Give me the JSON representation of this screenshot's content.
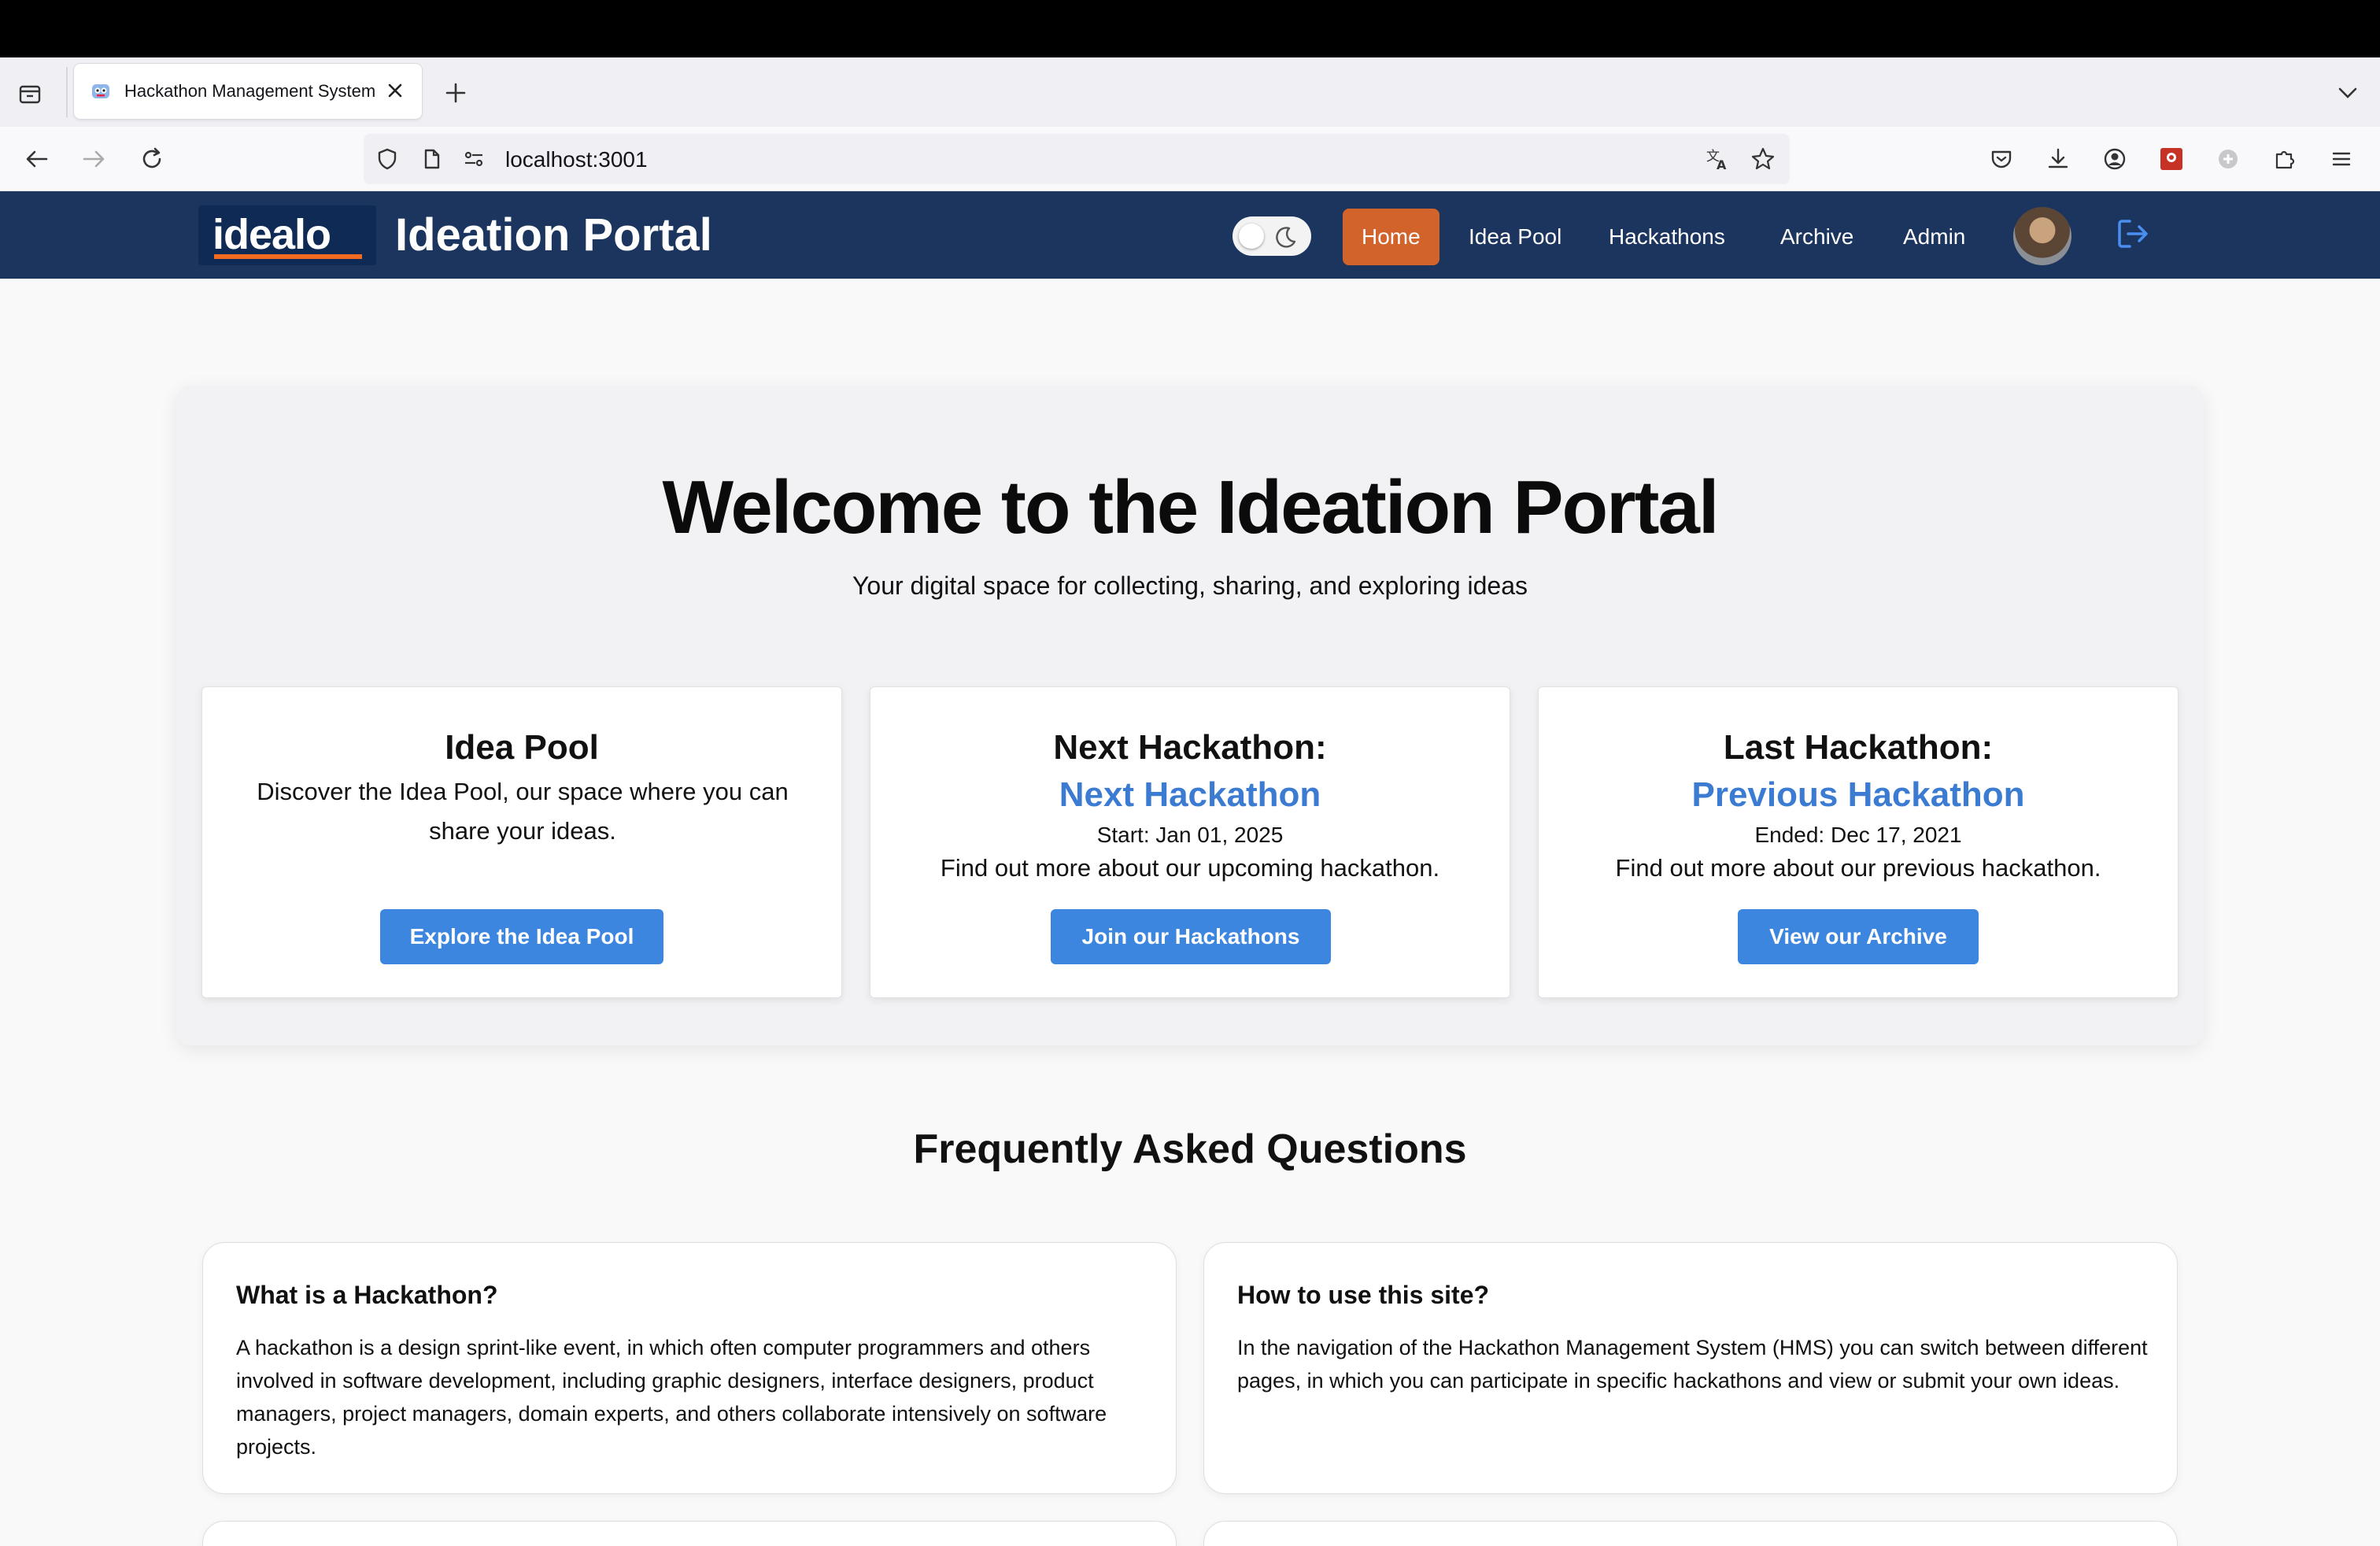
{
  "browser": {
    "tab": {
      "title": "Hackathon Management System"
    },
    "url": "localhost:3001",
    "icons": {
      "tab_list": "tab-list-icon",
      "tab_close": "close-icon",
      "new_tab": "plus-icon",
      "tab_overflow": "chevron-down-icon",
      "back": "back-arrow-icon",
      "forward": "forward-arrow-icon",
      "reload": "reload-icon",
      "shield": "shield-icon",
      "page": "page-icon",
      "permissions": "permissions-icon",
      "translate": "translate-icon",
      "bookmark": "star-icon",
      "pocket": "pocket-icon",
      "downloads": "download-icon",
      "account": "account-icon",
      "extension1": "extension-icon",
      "extension2": "extension-icon",
      "extensions": "puzzle-icon",
      "menu": "hamburger-menu-icon"
    }
  },
  "header": {
    "logo": "idealo",
    "title": "Ideation Portal",
    "nav": [
      {
        "label": "Home",
        "active": true
      },
      {
        "label": "Idea Pool",
        "active": false
      },
      {
        "label": "Hackathons",
        "active": false
      },
      {
        "label": "Archive",
        "active": false
      },
      {
        "label": "Admin",
        "active": false
      }
    ],
    "colors": {
      "background": "#1c355e",
      "active": "#d2632a",
      "accent": "#f26b21"
    }
  },
  "hero": {
    "title": "Welcome to the Ideation Portal",
    "subtitle": "Your digital space for collecting, sharing, and exploring ideas",
    "cards": [
      {
        "title": "Idea Pool",
        "description": "Discover the Idea Pool, our space where you can share your ideas.",
        "button": "Explore the Idea Pool"
      },
      {
        "title": "Next Hackathon:",
        "link": "Next Hackathon",
        "date": "Start: Jan 01, 2025",
        "more": "Find out more about our upcoming hackathon.",
        "button": "Join our Hackathons"
      },
      {
        "title": "Last Hackathon:",
        "link": "Previous Hackathon",
        "date": "Ended: Dec 17, 2021",
        "more": "Find out more about our previous hackathon.",
        "button": "View our Archive"
      }
    ]
  },
  "faq": {
    "title": "Frequently Asked Questions",
    "items": [
      {
        "question": "What is a Hackathon?",
        "answer": "A hackathon is a design sprint-like event, in which often computer programmers and others involved in software development, including graphic designers, interface designers, product managers, project managers, domain experts, and others collaborate intensively on software projects."
      },
      {
        "question": "How to use this site?",
        "answer": "In the navigation of the Hackathon Management System (HMS) you can switch between different pages, in which you can participate in specific hackathons and view or submit your own ideas."
      }
    ]
  }
}
